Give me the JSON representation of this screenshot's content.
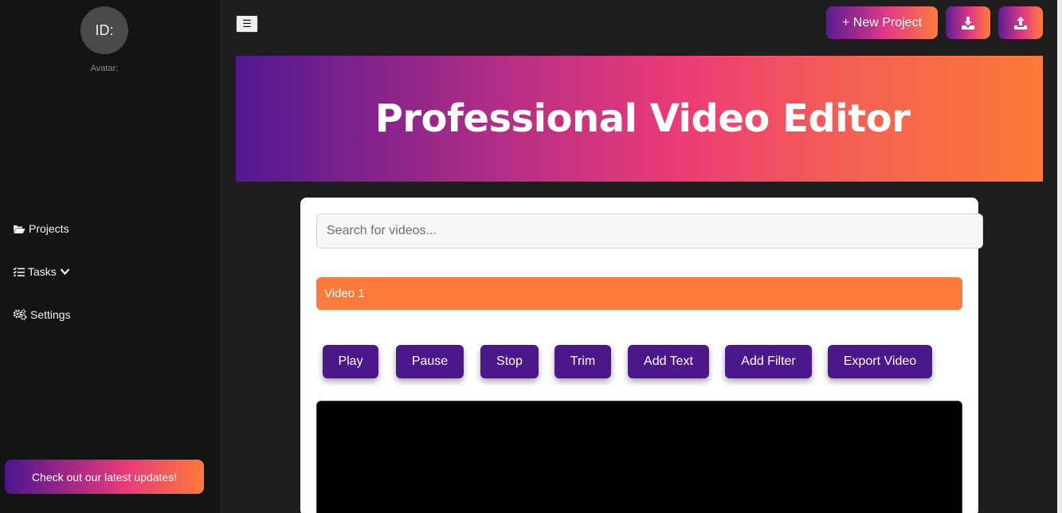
{
  "sidebar": {
    "avatar_text": "ID:",
    "avatar_caption": "Avatar:",
    "nav": [
      {
        "label": "Projects",
        "icon": "folder-open-icon"
      },
      {
        "label": "Tasks",
        "icon": "tasks-list-icon",
        "dropdown_icon": "chevron-down-icon"
      },
      {
        "label": "Settings",
        "icon": "gears-icon"
      }
    ],
    "promo_label": "Check out our latest updates!"
  },
  "header": {
    "menu_toggle": "☰",
    "new_project_label": "+ New Project",
    "download_icon": "download-icon",
    "upload_icon": "upload-icon"
  },
  "banner": {
    "title": "Professional Video Editor"
  },
  "editor": {
    "search_placeholder": "Search for videos...",
    "videos": [
      "Video 1"
    ],
    "controls": [
      "Play",
      "Pause",
      "Stop",
      "Trim",
      "Add Text",
      "Add Filter",
      "Export Video"
    ]
  },
  "colors": {
    "accent_purple": "#4b1889",
    "accent_orange": "#fd7a3d",
    "accent_pink": "#e8397a"
  }
}
